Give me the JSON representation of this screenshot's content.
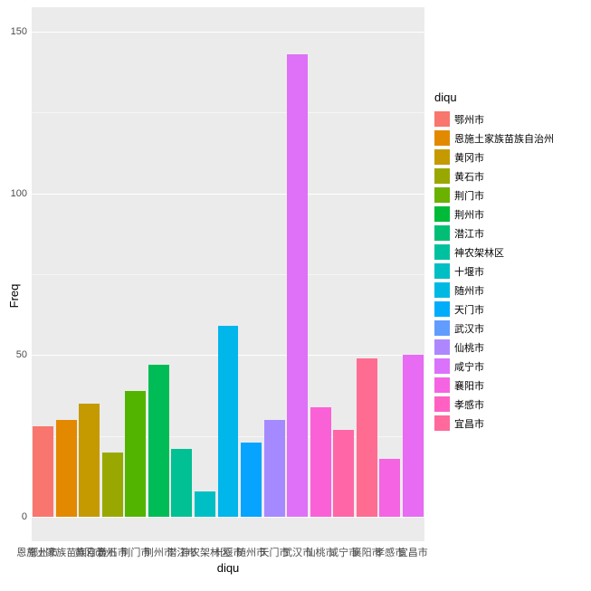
{
  "chart_data": {
    "type": "bar",
    "title": "",
    "xlabel": "diqu",
    "ylabel": "Freq",
    "ylim": [
      0,
      150
    ],
    "yticks": [
      0,
      50,
      100,
      150
    ],
    "categories": [
      "鄂州市",
      "恩施土家族苗族自治州",
      "黄冈市",
      "黄石市",
      "荆门市",
      "荆州市",
      "潜江市",
      "神农架林区",
      "十堰市",
      "随州市",
      "天门市",
      "武汉市",
      "仙桃市",
      "咸宁市",
      "襄阳市",
      "孝感市",
      "宜昌市"
    ],
    "values": [
      28,
      30,
      35,
      20,
      39,
      47,
      21,
      8,
      59,
      23,
      30,
      143,
      34,
      27,
      49,
      18,
      50
    ],
    "colors": [
      "#F8766D",
      "#E38900",
      "#C49A00",
      "#99A800",
      "#53B400",
      "#00BC56",
      "#00C094",
      "#00BFC4",
      "#00B6EB",
      "#06A4FF",
      "#A58AFF",
      "#DF70F8",
      "#FB61D7",
      "#FF66A8",
      "#FF6C91",
      "#F564E3",
      "#E76BF3"
    ],
    "legend_title": "diqu",
    "legend_items": [
      {
        "label": "鄂州市",
        "color": "#F8766D"
      },
      {
        "label": "恩施土家族苗族自治州",
        "color": "#E38900"
      },
      {
        "label": "黄冈市",
        "color": "#C49A00"
      },
      {
        "label": "黄石市",
        "color": "#99A800"
      },
      {
        "label": "荆门市",
        "color": "#6BB100"
      },
      {
        "label": "荆州市",
        "color": "#00BA38"
      },
      {
        "label": "潜江市",
        "color": "#00BF74"
      },
      {
        "label": "神农架林区",
        "color": "#00C19F"
      },
      {
        "label": "十堰市",
        "color": "#00BFC4"
      },
      {
        "label": "随州市",
        "color": "#00B9E3"
      },
      {
        "label": "天门市",
        "color": "#00ADFA"
      },
      {
        "label": "武汉市",
        "color": "#619CFF"
      },
      {
        "label": "仙桃市",
        "color": "#AE87FF"
      },
      {
        "label": "咸宁市",
        "color": "#DB72FB"
      },
      {
        "label": "襄阳市",
        "color": "#F564E3"
      },
      {
        "label": "孝感市",
        "color": "#FF61C3"
      },
      {
        "label": "宜昌市",
        "color": "#FF699C"
      }
    ]
  }
}
